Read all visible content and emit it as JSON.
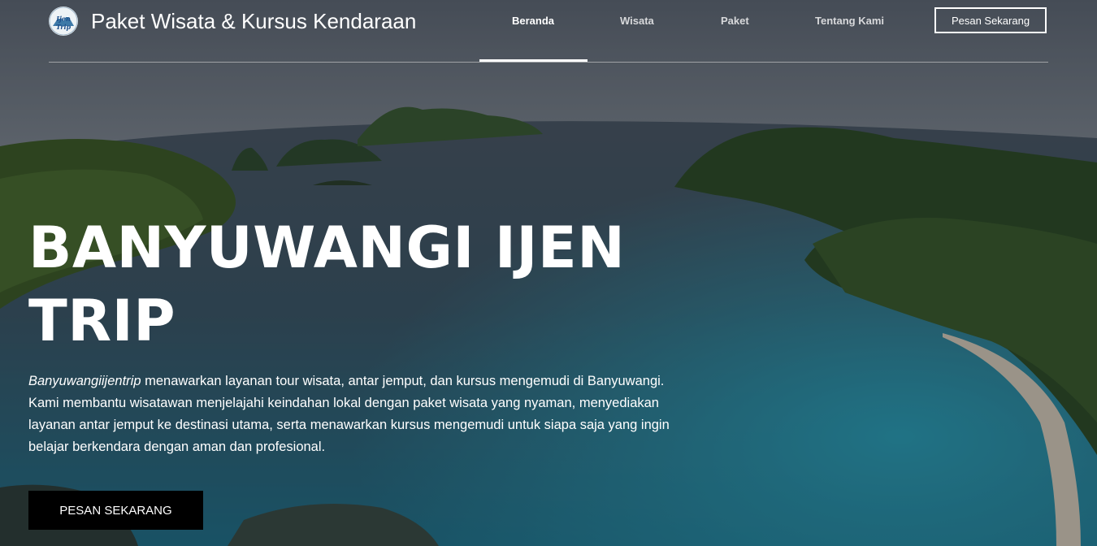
{
  "brand": {
    "logo_text": "Ijen Trip",
    "title": "Paket Wisata & Kursus Kendaraan"
  },
  "nav": {
    "items": [
      {
        "label": "Beranda",
        "active": true
      },
      {
        "label": "Wisata",
        "active": false
      },
      {
        "label": "Paket",
        "active": false
      },
      {
        "label": "Tentang Kami",
        "active": false
      }
    ],
    "cta_label": "Pesan Sekarang"
  },
  "hero": {
    "headline_line1": "BANYUWANGI IJEN",
    "headline_line2": "TRIP",
    "description_brand": "Banyuwangiijentrip",
    "description_rest": " menawarkan layanan tour wisata, antar jemput, dan kursus mengemudi di Banyuwangi. Kami membantu wisatawan menjelajahi keindahan lokal dengan paket wisata yang nyaman, menyediakan layanan antar jemput ke destinasi utama, serta menawarkan kursus mengemudi untuk siapa saja yang ingin belajar berkendara dengan aman dan profesional.",
    "cta_label": "PESAN SEKARANG"
  },
  "colors": {
    "sky": "#9aa6b2",
    "sea": "#1f6f86",
    "forest": "#355a2a",
    "button": "#000000"
  }
}
